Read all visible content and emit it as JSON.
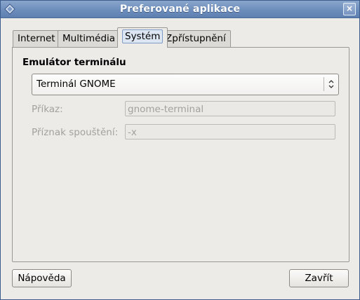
{
  "window": {
    "title": "Preferované aplikace",
    "close_label": "×"
  },
  "tabs": [
    {
      "label": "Internet"
    },
    {
      "label": "Multimédia"
    },
    {
      "label": "Systém"
    },
    {
      "label": "Zpřístupnění"
    }
  ],
  "active_tab": "Systém",
  "system": {
    "section_title": "Emulátor terminálu",
    "terminal_select": {
      "selected": "Terminál GNOME"
    },
    "command": {
      "label": "Příkaz:",
      "value": "gnome-terminal"
    },
    "exec_flag": {
      "label": "Příznak spouštění:",
      "value": "-x"
    }
  },
  "buttons": {
    "help": "Nápověda",
    "close": "Zavřít"
  }
}
